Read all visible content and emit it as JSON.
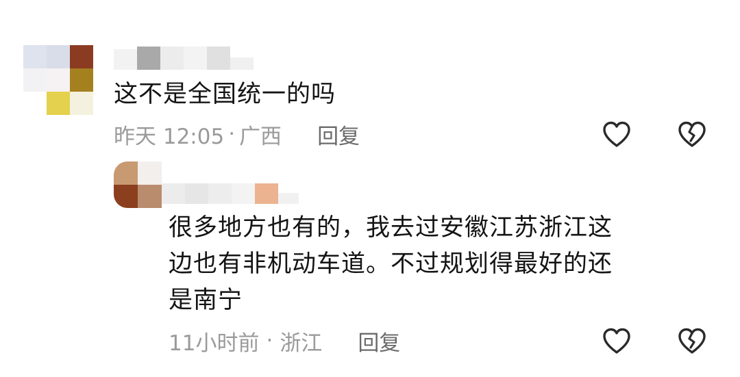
{
  "comments": [
    {
      "text": "这不是全国统一的吗",
      "time": "昨天 12:05",
      "separator": "·",
      "location": "广西",
      "reply_label": "回复",
      "like_icon": "heart-outline-icon",
      "dislike_icon": "broken-heart-icon"
    },
    {
      "lines": [
        "很多地方也有的，我去过安徽江苏浙江这",
        "边也有非机动车道。不过规划得最好的还",
        "是南宁"
      ],
      "time": "11小时前",
      "separator": "·",
      "location": "浙江",
      "reply_label": "回复",
      "like_icon": "heart-outline-icon",
      "dislike_icon": "broken-heart-icon"
    }
  ],
  "colors": {
    "text": "#141414",
    "meta": "#9a9a9a",
    "reply": "#6b6b6b",
    "icon": "#2a2a2a"
  }
}
